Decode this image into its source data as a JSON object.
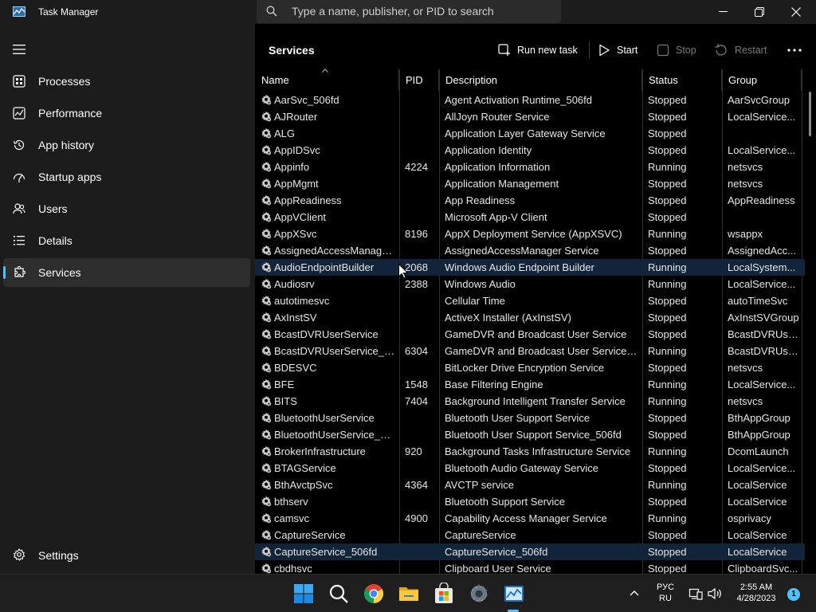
{
  "app": {
    "title": "Task Manager"
  },
  "search": {
    "placeholder": "Type a name, publisher, or PID to search"
  },
  "sidebar": {
    "items": [
      {
        "label": "Processes"
      },
      {
        "label": "Performance"
      },
      {
        "label": "App history"
      },
      {
        "label": "Startup apps"
      },
      {
        "label": "Users"
      },
      {
        "label": "Details"
      },
      {
        "label": "Services"
      }
    ],
    "settings_label": "Settings",
    "active_item": "Services"
  },
  "main": {
    "title": "Services",
    "toolbar": {
      "run_new_task": "Run new task",
      "start": "Start",
      "stop": "Stop",
      "restart": "Restart"
    },
    "columns": [
      "Name",
      "PID",
      "Description",
      "Status",
      "Group"
    ],
    "rows": [
      [
        "AarSvc_506fd",
        "",
        "Agent Activation Runtime_506fd",
        "Stopped",
        "AarSvcGroup"
      ],
      [
        "AJRouter",
        "",
        "AllJoyn Router Service",
        "Stopped",
        "LocalService..."
      ],
      [
        "ALG",
        "",
        "Application Layer Gateway Service",
        "Stopped",
        ""
      ],
      [
        "AppIDSvc",
        "",
        "Application Identity",
        "Stopped",
        "LocalService..."
      ],
      [
        "Appinfo",
        "4224",
        "Application Information",
        "Running",
        "netsvcs"
      ],
      [
        "AppMgmt",
        "",
        "Application Management",
        "Stopped",
        "netsvcs"
      ],
      [
        "AppReadiness",
        "",
        "App Readiness",
        "Stopped",
        "AppReadiness"
      ],
      [
        "AppVClient",
        "",
        "Microsoft App-V Client",
        "Stopped",
        ""
      ],
      [
        "AppXSvc",
        "8196",
        "AppX Deployment Service (AppXSVC)",
        "Running",
        "wsappx"
      ],
      [
        "AssignedAccessManager...",
        "",
        "AssignedAccessManager Service",
        "Stopped",
        "AssignedAcc..."
      ],
      [
        "AudioEndpointBuilder",
        "2068",
        "Windows Audio Endpoint Builder",
        "Running",
        "LocalSystem..."
      ],
      [
        "Audiosrv",
        "2388",
        "Windows Audio",
        "Running",
        "LocalService..."
      ],
      [
        "autotimesvc",
        "",
        "Cellular Time",
        "Stopped",
        "autoTimeSvc"
      ],
      [
        "AxInstSV",
        "",
        "ActiveX Installer (AxInstSV)",
        "Stopped",
        "AxInstSVGroup"
      ],
      [
        "BcastDVRUserService",
        "",
        "GameDVR and Broadcast User Service",
        "Stopped",
        "BcastDVRUse..."
      ],
      [
        "BcastDVRUserService_50...",
        "6304",
        "GameDVR and Broadcast User Service_...",
        "Running",
        "BcastDVRUse..."
      ],
      [
        "BDESVC",
        "",
        "BitLocker Drive Encryption Service",
        "Stopped",
        "netsvcs"
      ],
      [
        "BFE",
        "1548",
        "Base Filtering Engine",
        "Running",
        "LocalService..."
      ],
      [
        "BITS",
        "7404",
        "Background Intelligent Transfer Service",
        "Running",
        "netsvcs"
      ],
      [
        "BluetoothUserService",
        "",
        "Bluetooth User Support Service",
        "Stopped",
        "BthAppGroup"
      ],
      [
        "BluetoothUserService_50...",
        "",
        "Bluetooth User Support Service_506fd",
        "Stopped",
        "BthAppGroup"
      ],
      [
        "BrokerInfrastructure",
        "920",
        "Background Tasks Infrastructure Service",
        "Running",
        "DcomLaunch"
      ],
      [
        "BTAGService",
        "",
        "Bluetooth Audio Gateway Service",
        "Stopped",
        "LocalService..."
      ],
      [
        "BthAvctpSvc",
        "4364",
        "AVCTP service",
        "Running",
        "LocalService"
      ],
      [
        "bthserv",
        "",
        "Bluetooth Support Service",
        "Stopped",
        "LocalService"
      ],
      [
        "camsvc",
        "4900",
        "Capability Access Manager Service",
        "Running",
        "osprivacy"
      ],
      [
        "CaptureService",
        "",
        "CaptureService",
        "Stopped",
        "LocalService"
      ],
      [
        "CaptureService_506fd",
        "",
        "CaptureService_506fd",
        "Stopped",
        "LocalService"
      ],
      [
        "cbdhsvc",
        "",
        "Clipboard User Service",
        "Stopped",
        "ClipboardSvc..."
      ]
    ],
    "selected_rows": [
      "AudioEndpointBuilder",
      "CaptureService_506fd"
    ]
  },
  "taskbar": {
    "language_top": "РУС",
    "language_bottom": "RU",
    "time": "2:55 AM",
    "date": "4/28/2023",
    "notification_count": "1"
  },
  "colors": {
    "accent": "#4cc2ff",
    "selected_row": "#11243a",
    "sidebar_bg": "#1c1c1c"
  }
}
